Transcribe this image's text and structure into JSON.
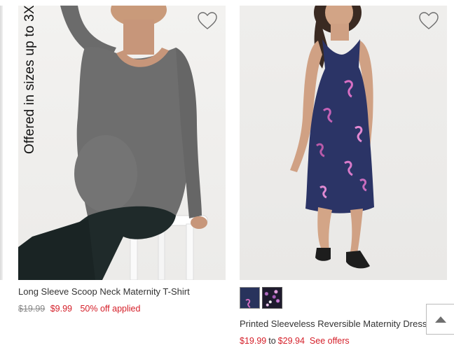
{
  "products": [
    {
      "banner": "Offered in sizes up to 3X",
      "title": "Long Sleeve Scoop Neck Maternity T-Shirt",
      "price_old": "$19.99",
      "price_new": "$9.99",
      "price_note": "50% off applied",
      "icon": "heart-outline-icon"
    },
    {
      "title": "Printed Sleeveless Reversible Maternity Dress",
      "price_low": "$19.99",
      "price_sep": "to",
      "price_high": "$29.94",
      "offers_link": "See offers",
      "swatches": [
        "navy",
        "print"
      ],
      "icon": "heart-outline-icon"
    }
  ],
  "back_to_top_icon": "caret-up-icon",
  "colors": {
    "sale_red": "#d5202a",
    "text": "#333333",
    "strike": "#888888"
  }
}
